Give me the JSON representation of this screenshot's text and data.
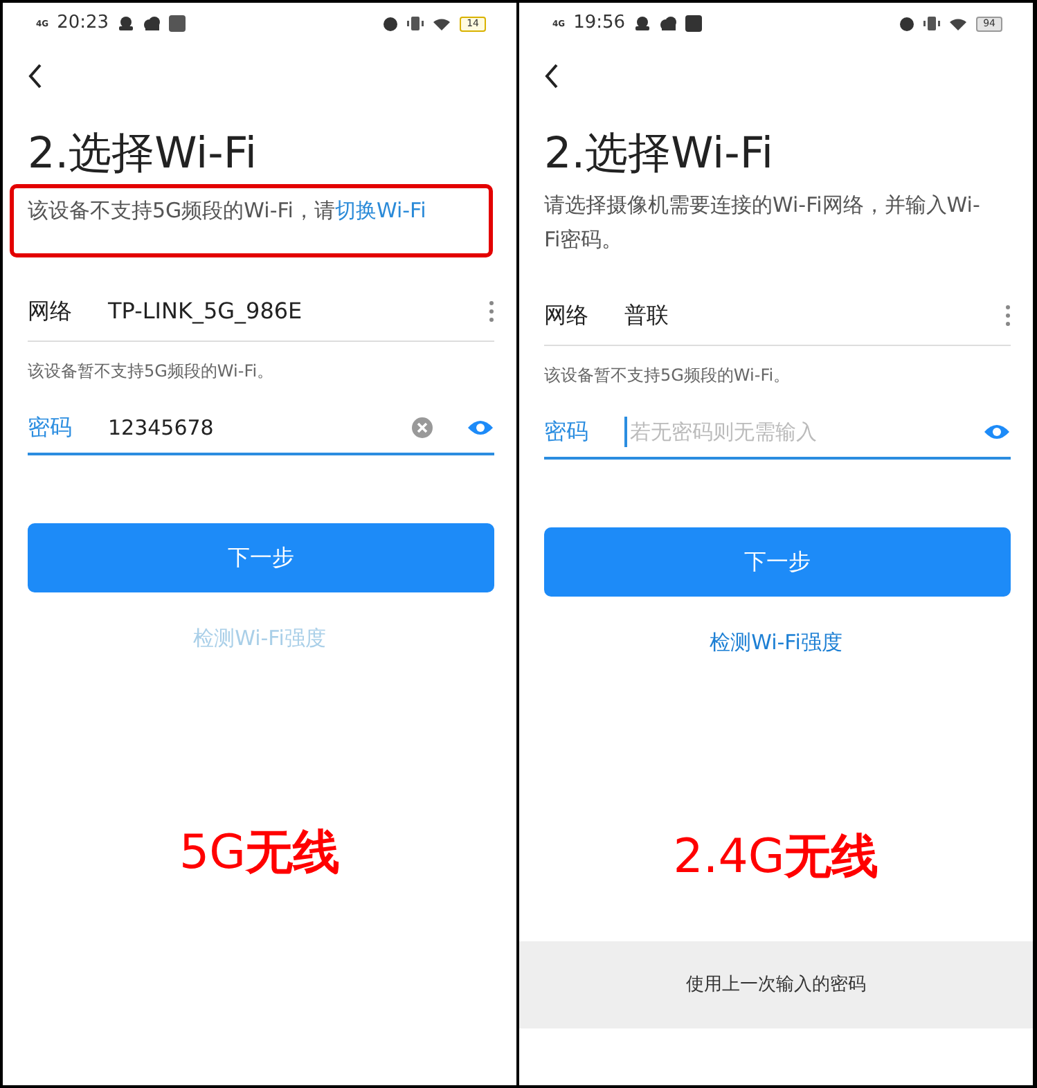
{
  "panels": [
    {
      "status_bar": {
        "network": "4G",
        "time": "20:23",
        "battery": "14",
        "battery_low": true
      },
      "title": "2.选择Wi-Fi",
      "highlighted": true,
      "description": [
        {
          "kind": "text",
          "text": "该设备不支持5G频段的Wi-Fi，请"
        },
        {
          "kind": "link",
          "text": "切换Wi-Fi"
        }
      ],
      "network": {
        "label": "网络",
        "value": "TP-LINK_5G_986E"
      },
      "hint": "该设备暂不支持5G频段的Wi-Fi。",
      "password": {
        "label": "密码",
        "value": "12345678",
        "clear_button": true,
        "cursor": false
      },
      "next_button": "下一步",
      "detect_link": {
        "text": "检测Wi-Fi强度",
        "disabled": true
      },
      "caption": "5G**无线**"
    },
    {
      "status_bar": {
        "network": "4G",
        "time": "19:56",
        "battery": "94",
        "battery_low": false
      },
      "title": "2.选择Wi-Fi",
      "highlighted": false,
      "description": [
        {
          "kind": "text",
          "text": "请选择摄像机需要连接的Wi-Fi网络，并输入Wi-Fi密码。"
        }
      ],
      "network": {
        "label": "网络",
        "value": "普联"
      },
      "hint": "该设备暂不支持5G频段的Wi-Fi。",
      "password": {
        "label": "密码",
        "placeholder": "若无密码则无需输入",
        "clear_button": false,
        "cursor": true
      },
      "next_button": "下一步",
      "detect_link": {
        "text": "检测Wi-Fi强度",
        "disabled": false
      },
      "caption": "2.4G**无线**",
      "bottom_option": "使用上一次输入的密码"
    }
  ]
}
